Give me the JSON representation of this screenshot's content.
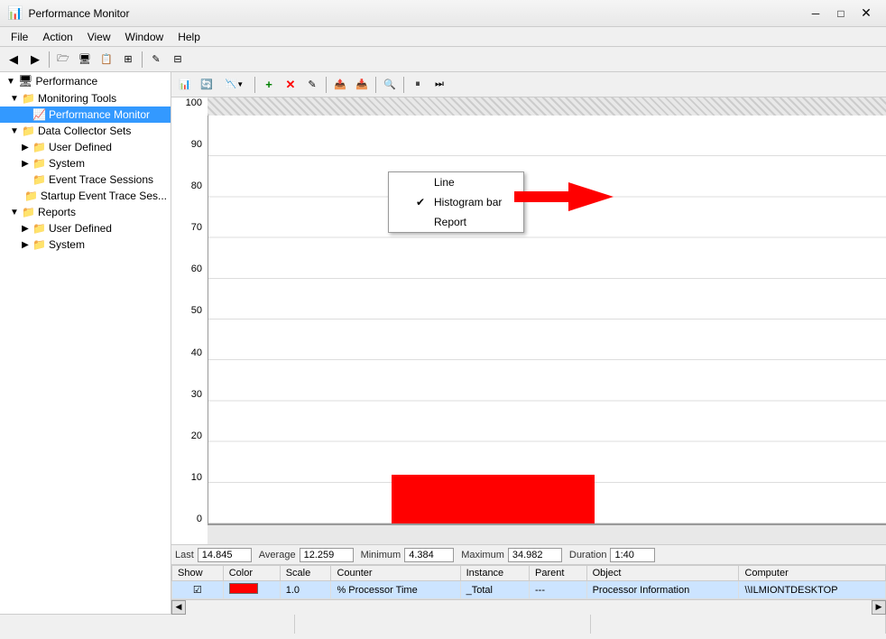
{
  "window": {
    "title": "Performance Monitor",
    "icon": "📊"
  },
  "menubar": {
    "items": [
      "File",
      "Action",
      "View",
      "Window",
      "Help"
    ]
  },
  "toolbar_main": {
    "buttons": [
      "⬅",
      "➡",
      "📁",
      "🖥",
      "📋",
      "🗒",
      "🖊",
      "📤"
    ]
  },
  "sidebar": {
    "root_label": "Performance",
    "items": [
      {
        "id": "performance",
        "label": "Performance",
        "level": 0,
        "expanded": true,
        "icon": "📊"
      },
      {
        "id": "monitoring-tools",
        "label": "Monitoring Tools",
        "level": 1,
        "expanded": true,
        "icon": "📁"
      },
      {
        "id": "performance-monitor",
        "label": "Performance Monitor",
        "level": 2,
        "selected": true,
        "icon": "📈"
      },
      {
        "id": "data-collector-sets",
        "label": "Data Collector Sets",
        "level": 1,
        "expanded": true,
        "icon": "📁"
      },
      {
        "id": "user-defined",
        "label": "User Defined",
        "level": 2,
        "icon": "📁"
      },
      {
        "id": "system",
        "label": "System",
        "level": 2,
        "icon": "📁"
      },
      {
        "id": "event-trace-sessions",
        "label": "Event Trace Sessions",
        "level": 2,
        "icon": "📁"
      },
      {
        "id": "startup-event-trace",
        "label": "Startup Event Trace Ses...",
        "level": 2,
        "icon": "📁"
      },
      {
        "id": "reports",
        "label": "Reports",
        "level": 1,
        "expanded": true,
        "icon": "📁"
      },
      {
        "id": "reports-user-defined",
        "label": "User Defined",
        "level": 2,
        "icon": "📁"
      },
      {
        "id": "reports-system",
        "label": "System",
        "level": 2,
        "icon": "📁"
      }
    ]
  },
  "monitor_toolbar": {
    "buttons": [
      "📊",
      "🔄",
      "📋",
      "▼",
      "➕",
      "✖",
      "✏",
      "📤",
      "📥",
      "🔍",
      "⏸",
      "⏭"
    ]
  },
  "dropdown": {
    "visible": true,
    "items": [
      {
        "id": "line",
        "label": "Line",
        "checked": false
      },
      {
        "id": "histogram-bar",
        "label": "Histogram bar",
        "checked": true
      },
      {
        "id": "report",
        "label": "Report",
        "checked": false
      }
    ]
  },
  "chart": {
    "y_labels": [
      "100",
      "90",
      "80",
      "70",
      "60",
      "50",
      "40",
      "30",
      "20",
      "10",
      "0"
    ]
  },
  "status": {
    "last_label": "Last",
    "last_value": "14.845",
    "average_label": "Average",
    "average_value": "12.259",
    "minimum_label": "Minimum",
    "minimum_value": "4.384",
    "maximum_label": "Maximum",
    "maximum_value": "34.982",
    "duration_label": "Duration",
    "duration_value": "1:40"
  },
  "table": {
    "headers": [
      "Show",
      "Color",
      "Scale",
      "Counter",
      "Instance",
      "Parent",
      "Object",
      "Computer"
    ],
    "rows": [
      {
        "show": "☑",
        "color": "red",
        "scale": "1.0",
        "counter": "% Processor Time",
        "instance": "_Total",
        "parent": "---",
        "object": "Processor Information",
        "computer": "\\\\ILMIONTDESKTOP"
      }
    ]
  }
}
